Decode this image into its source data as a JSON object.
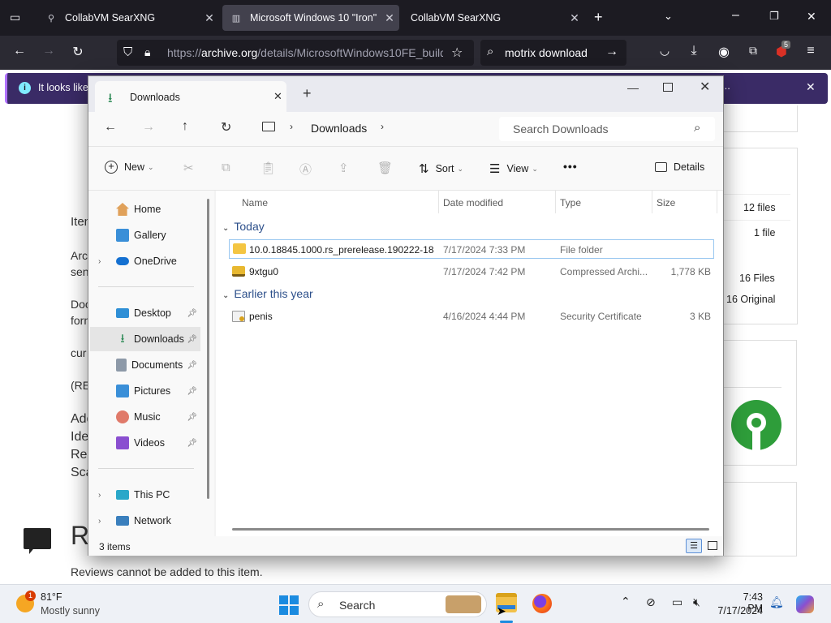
{
  "browser": {
    "tabs": [
      {
        "title": "CollabVM SearXNG"
      },
      {
        "title": "Microsoft Windows 10 \"Iron\" D"
      },
      {
        "title": "CollabVM SearXNG"
      }
    ],
    "url_prefix": "https://",
    "url_main": "archive.org",
    "url_rest": "/details/MicrosoftWindows10FE_build",
    "search_text": "motrix download",
    "extension_badge": "5",
    "notification_text": "It looks like"
  },
  "webpage": {
    "left_texts": [
      "Iten",
      "Arc",
      "sen",
      "Doc",
      "forn",
      "cur",
      "(RE",
      "Add",
      "Ide",
      "Re",
      "Sca"
    ],
    "review_heading": "R",
    "reviews_text": "Reviews cannot be added to this item.",
    "right_rows": [
      "12 files",
      "1 file",
      "16 Files",
      "16 Original"
    ]
  },
  "explorer": {
    "tab_title": "Downloads",
    "breadcrumb": "Downloads",
    "search_placeholder": "Search Downloads",
    "commands": {
      "new": "New",
      "sort": "Sort",
      "view": "View",
      "details": "Details",
      "more": "•••"
    },
    "nav": [
      {
        "label": "Home"
      },
      {
        "label": "Gallery"
      },
      {
        "label": "OneDrive"
      },
      {
        "label": "Desktop"
      },
      {
        "label": "Downloads"
      },
      {
        "label": "Documents"
      },
      {
        "label": "Pictures"
      },
      {
        "label": "Music"
      },
      {
        "label": "Videos"
      },
      {
        "label": "This PC"
      },
      {
        "label": "Network"
      }
    ],
    "columns": [
      "Name",
      "Date modified",
      "Type",
      "Size"
    ],
    "groups": [
      {
        "label": "Today",
        "items": [
          {
            "name": "10.0.18845.1000.rs_prerelease.190222-184...",
            "date": "7/17/2024 7:33 PM",
            "type": "File folder",
            "size": ""
          },
          {
            "name": "9xtgu0",
            "date": "7/17/2024 7:42 PM",
            "type": "Compressed Archi...",
            "size": "1,778 KB"
          }
        ]
      },
      {
        "label": "Earlier this year",
        "items": [
          {
            "name": "penis",
            "date": "4/16/2024 4:44 PM",
            "type": "Security Certificate",
            "size": "3 KB"
          }
        ]
      }
    ],
    "status": "3 items"
  },
  "taskbar": {
    "weather_temp": "81°F",
    "weather_desc": "Mostly sunny",
    "weather_badge": "1",
    "search_label": "Search",
    "time": "7:43 PM",
    "date": "7/17/2024"
  }
}
